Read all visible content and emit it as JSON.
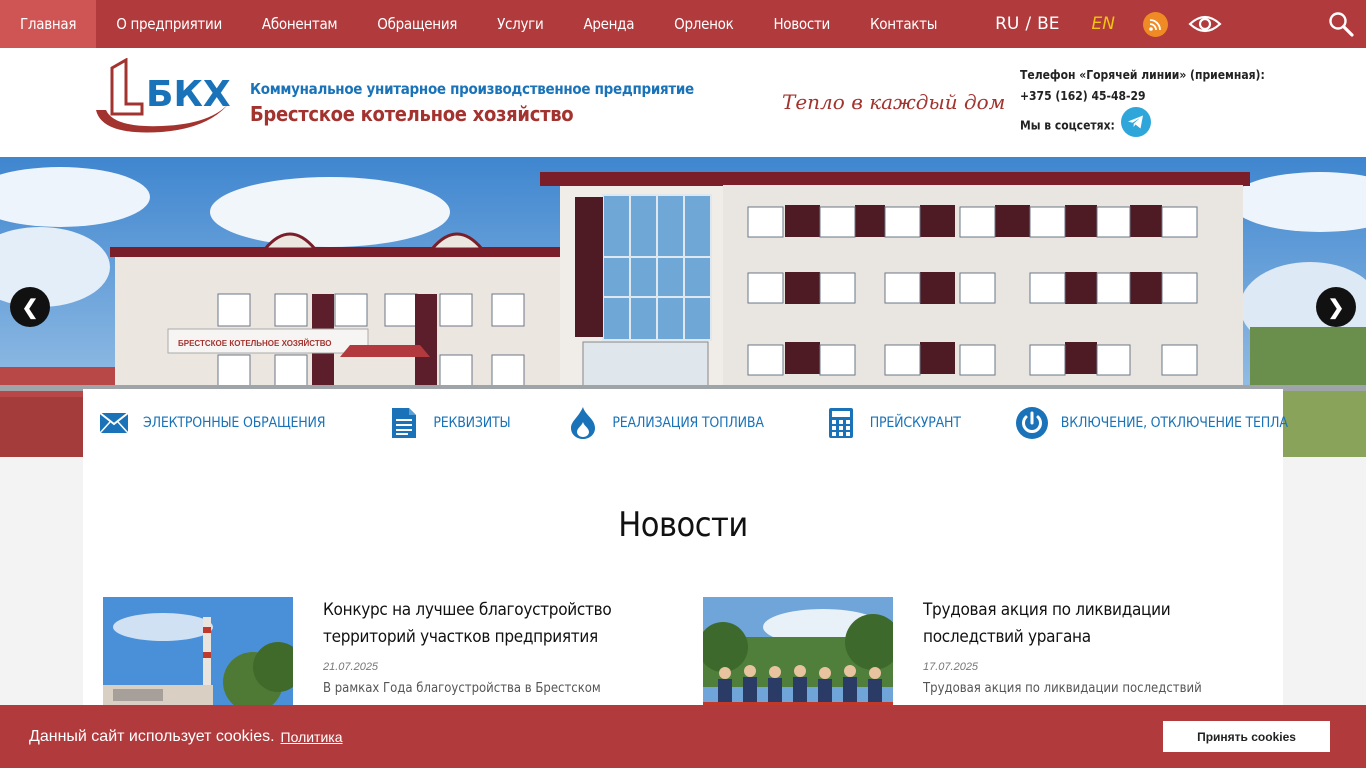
{
  "nav": {
    "items": [
      {
        "label": "Главная",
        "active": true
      },
      {
        "label": "О предприятии"
      },
      {
        "label": "Абонентам"
      },
      {
        "label": "Обращения"
      },
      {
        "label": "Услуги"
      },
      {
        "label": "Аренда"
      },
      {
        "label": "Орленок"
      },
      {
        "label": "Новости"
      },
      {
        "label": "Контакты"
      }
    ],
    "lang_ru": "RU",
    "lang_sep": "/",
    "lang_be": "BE",
    "lang_en": "EN",
    "icons": {
      "rss": "rss-icon",
      "accessibility": "eye-icon",
      "search": "search-icon"
    }
  },
  "header": {
    "logo_text": "БКХ",
    "org_subtitle": "Коммунальное унитарное производственное предприятие",
    "org_name": "Брестское котельное хозяйство",
    "slogan": "Тепло в каждый дом",
    "hotline_label": "Телефон «Горячей линии» (приемная):",
    "hotline_phone": "+375 (162) 45-48-29",
    "social_label": "Мы в соцсетях:"
  },
  "hero": {
    "sign_text": "БРЕСТСКОЕ КОТЕЛЬНОЕ ХОЗЯЙСТВО",
    "prev": "❮",
    "next": "❯"
  },
  "quick_links": [
    {
      "label": "ЭЛЕКТРОННЫЕ ОБРАЩЕНИЯ",
      "icon": "envelope-icon"
    },
    {
      "label": "РЕКВИЗИТЫ",
      "icon": "document-icon"
    },
    {
      "label": "РЕАЛИЗАЦИЯ ТОПЛИВА",
      "icon": "flame-icon"
    },
    {
      "label": "ПРЕЙСКУРАНТ",
      "icon": "calculator-icon"
    },
    {
      "label": "ВКЛЮЧЕНИЕ, ОТКЛЮЧЕНИЕ ТЕПЛА",
      "icon": "power-icon"
    }
  ],
  "news": {
    "title": "Новости",
    "items": [
      {
        "title": "Конкурс на лучшее благоустройство территорий участков предприятия",
        "date": "21.07.2025",
        "excerpt": "В рамках Года благоустройства в Брестском"
      },
      {
        "title": "Трудовая акция по ликвидации последствий урагана",
        "date": "17.07.2025",
        "excerpt": "Трудовая акция по ликвидации последствий"
      }
    ]
  },
  "cookie": {
    "message": "Данный сайт использует cookies.",
    "link": "Политика",
    "accept": "Принять cookies"
  },
  "colors": {
    "brand_red": "#b03a3c",
    "active_nav": "#cf5454",
    "link_blue": "#1a73b8",
    "rss_orange": "#f08a24",
    "telegram_blue": "#2ea6da"
  }
}
